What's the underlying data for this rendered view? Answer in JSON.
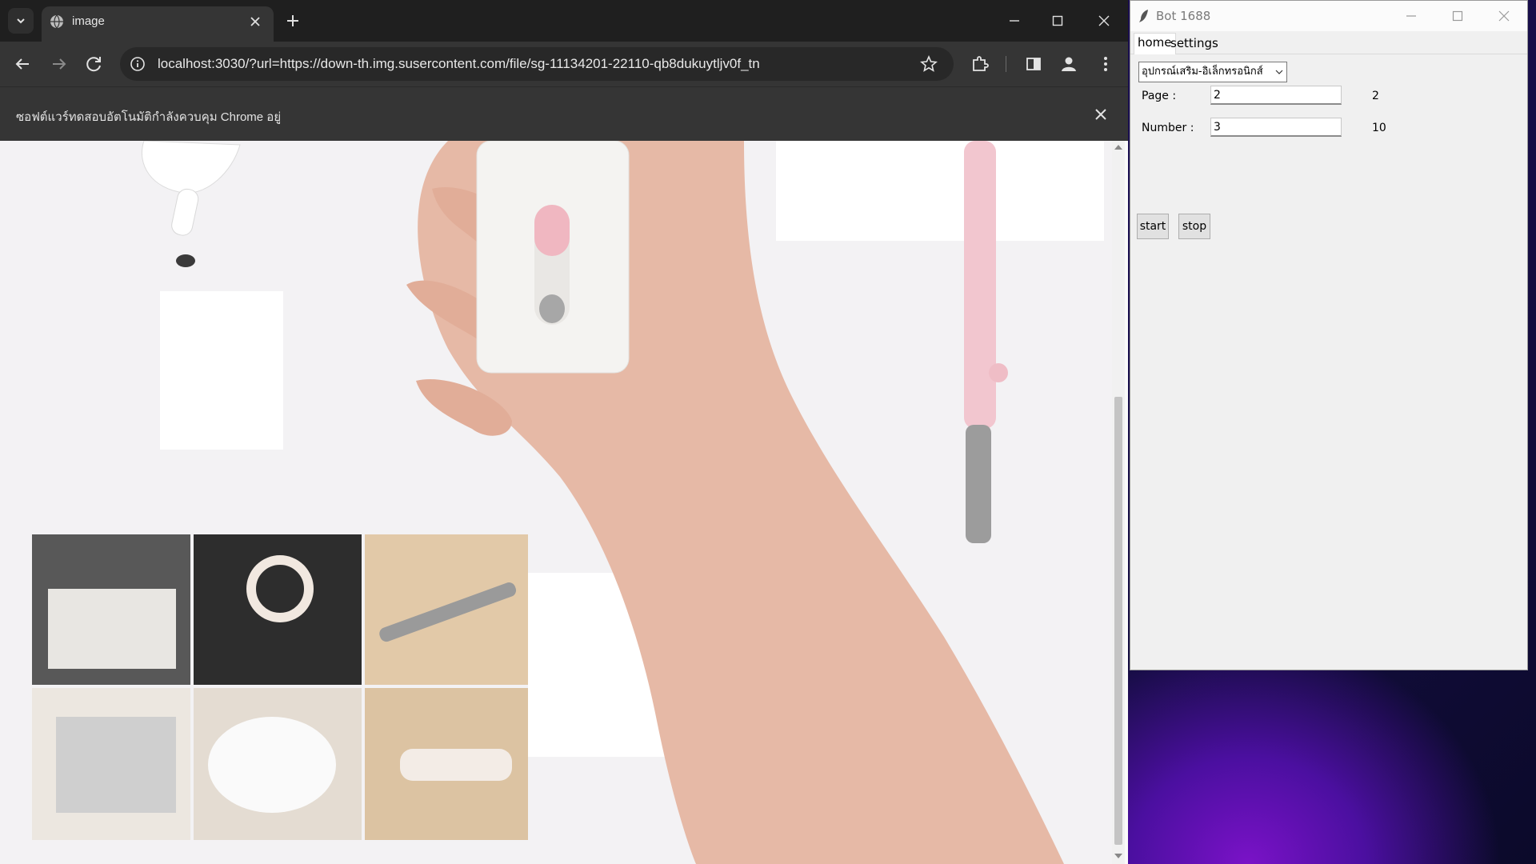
{
  "browser": {
    "tab": {
      "title": "image"
    },
    "address_bar": {
      "url": "localhost:3030/?url=https://down-th.img.susercontent.com/file/sg-11134201-22110-qb8dukuytljv0f_tn"
    },
    "infobar": {
      "message": "ซอฟต์แวร์ทดสอบอัตโนมัติกำลังควบคุม Chrome อยู่"
    },
    "icons": {
      "tab_search": "chevron-down-icon",
      "favicon": "globe-icon",
      "tab_close": "close-icon",
      "new_tab": "plus-icon",
      "back": "arrow-left-icon",
      "forward": "arrow-right-icon",
      "reload": "reload-icon",
      "site_info": "info-icon",
      "bookmark": "star-icon",
      "extensions": "puzzle-icon",
      "side_panel": "side-panel-icon",
      "profile": "profile-icon",
      "menu": "kebab-menu-icon"
    },
    "theme": {
      "frame": "#1f1f1f",
      "toolbar": "#353535",
      "text": "#e8e8e8"
    }
  },
  "bot_window": {
    "title": "Bot 1688",
    "tabs": [
      {
        "label": "home",
        "active": true
      },
      {
        "label": "settings",
        "active": false
      }
    ],
    "category_select": {
      "value": "อุปกรณ์เสริม-อิเล็กทรอนิกส์"
    },
    "page": {
      "label": "Page :",
      "value": "2",
      "display": "2"
    },
    "number": {
      "label": "Number :",
      "value": "3",
      "display": "10"
    },
    "buttons": {
      "start": "start",
      "stop": "stop"
    }
  }
}
